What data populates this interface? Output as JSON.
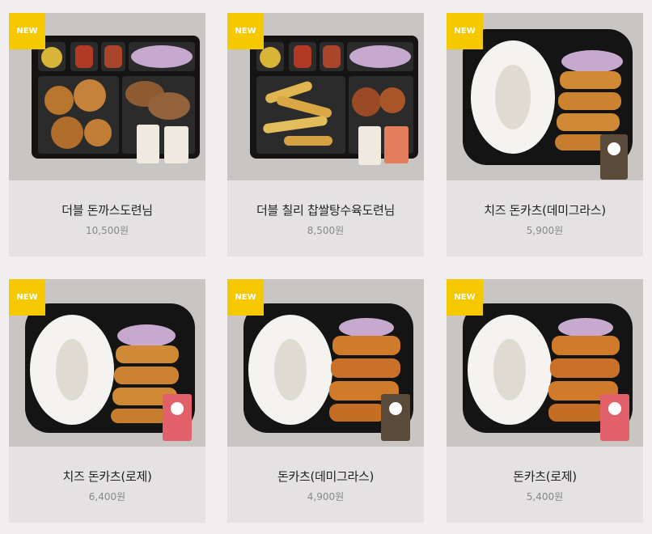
{
  "products": [
    {
      "name": "더블 돈까스도련님",
      "price": "10,500원",
      "badge": "NEW"
    },
    {
      "name": "더블 칠리 찹쌀탕수육도련님",
      "price": "8,500원",
      "badge": "NEW"
    },
    {
      "name": "치즈 돈카츠(데미그라스)",
      "price": "5,900원",
      "badge": "NEW"
    },
    {
      "name": "치즈 돈카츠(로제)",
      "price": "6,400원",
      "badge": "NEW"
    },
    {
      "name": "돈카츠(데미그라스)",
      "price": "4,900원",
      "badge": "NEW"
    },
    {
      "name": "돈카츠(로제)",
      "price": "5,400원",
      "badge": "NEW"
    }
  ],
  "colors": {
    "badge": "#f6c800",
    "card": "#e4e2e2",
    "photo_bg": "#cbc8c5",
    "page_bg": "#f0eeee"
  }
}
